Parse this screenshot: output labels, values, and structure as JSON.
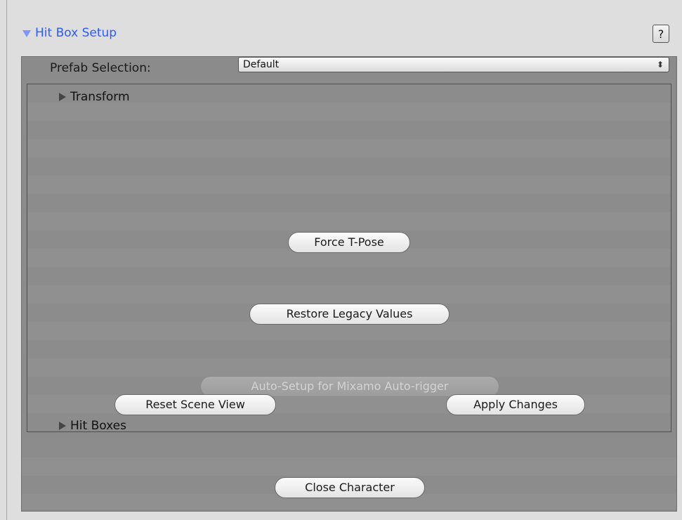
{
  "header": {
    "title": "Hit Box Setup",
    "help_label": "?"
  },
  "prefab": {
    "label": "Prefab Selection:",
    "value": "Default",
    "arrows": "⬍"
  },
  "sections": {
    "transform_label": "Transform",
    "hitboxes_label": "Hit Boxes"
  },
  "buttons": {
    "force_tpose": "Force T-Pose",
    "restore_legacy": "Restore Legacy Values",
    "auto_setup": "Auto-Setup for Mixamo Auto-rigger",
    "reset_scene": "Reset Scene View",
    "apply_changes": "Apply Changes",
    "close_character": "Close Character"
  }
}
